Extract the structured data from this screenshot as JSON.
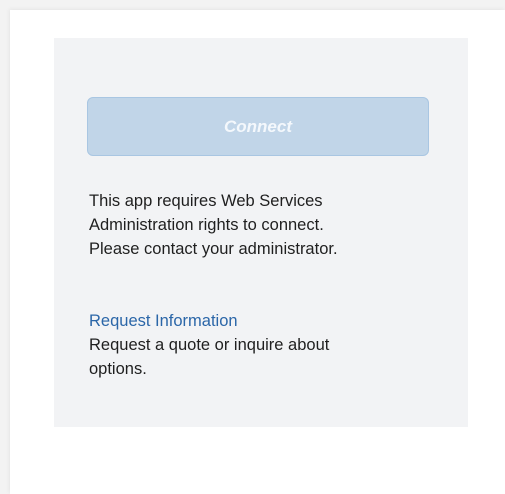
{
  "connect": {
    "label": "Connect",
    "enabled": false
  },
  "message": {
    "lines": [
      "This app requires Web Services",
      "Administration rights to connect.",
      "Please contact your administrator."
    ]
  },
  "request": {
    "link_label": "Request Information",
    "description_lines": [
      "Request a quote or inquire about",
      "options."
    ]
  },
  "colors": {
    "link": "#2b66a8",
    "button_disabled_bg": "#c1d5e8",
    "panel_bg": "#f2f3f5"
  }
}
